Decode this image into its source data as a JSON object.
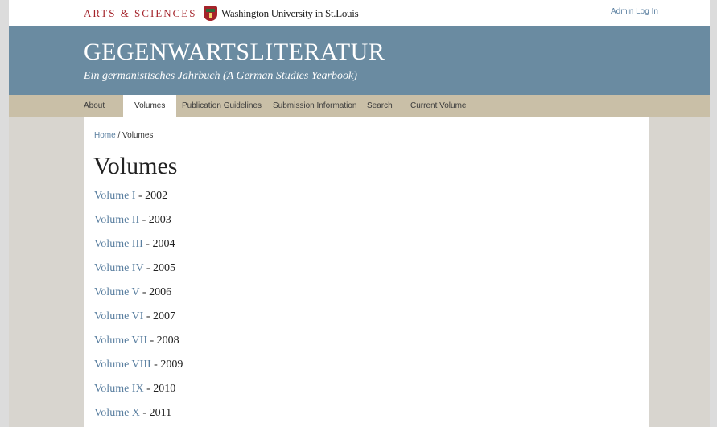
{
  "top_bar": {
    "arts": "ARTS & SCIENCES",
    "university": "Washington University in St.Louis",
    "admin_login": "Admin Log In"
  },
  "header": {
    "title": "GEGENWARTSLITERATUR",
    "subtitle": "Ein germanistisches Jahrbuch (A German Studies Yearbook)"
  },
  "nav": {
    "items": [
      {
        "label": "About"
      },
      {
        "label": "Volumes"
      },
      {
        "label": "Publication Guidelines"
      },
      {
        "label": "Submission Information"
      },
      {
        "label": "Search"
      },
      {
        "label": "Current Volume"
      }
    ],
    "active": "Volumes"
  },
  "breadcrumb": {
    "home": "Home",
    "separator": " / ",
    "current": "Volumes"
  },
  "page_title": "Volumes",
  "volumes": [
    {
      "label": "Volume I",
      "year": "2002"
    },
    {
      "label": "Volume II",
      "year": "2003"
    },
    {
      "label": "Volume III",
      "year": "2004"
    },
    {
      "label": "Volume IV",
      "year": "2005"
    },
    {
      "label": "Volume V",
      "year": "2006"
    },
    {
      "label": "Volume VI",
      "year": "2007"
    },
    {
      "label": "Volume VII",
      "year": "2008"
    },
    {
      "label": "Volume VIII",
      "year": "2009"
    },
    {
      "label": "Volume IX",
      "year": "2010"
    },
    {
      "label": "Volume X",
      "year": "2011"
    }
  ],
  "year_separator": " - ",
  "colors": {
    "header_bg": "#6a8ba1",
    "nav_bg": "#c9bfa7",
    "link": "#5a7fa0",
    "brand_red": "#a4232a"
  }
}
